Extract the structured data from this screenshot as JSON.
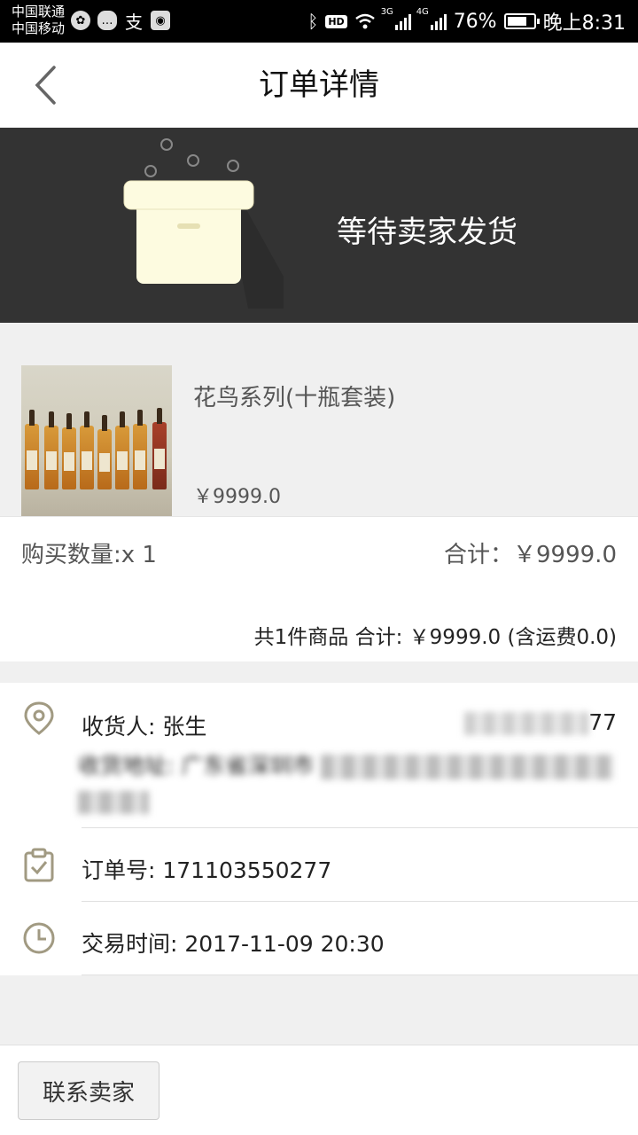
{
  "status_bar": {
    "carrier_1": "中国联通",
    "carrier_2": "中国移动",
    "hd": "HD",
    "net_1": "3G",
    "net_2": "4G",
    "battery": "76%",
    "time": "晚上8:31",
    "icons": [
      "weibo-icon",
      "chat-icon",
      "alipay-icon",
      "app-icon",
      "bluetooth-icon",
      "wifi-icon",
      "signal-icon",
      "battery-icon"
    ]
  },
  "header": {
    "title": "订单详情"
  },
  "banner": {
    "status": "等待卖家发货"
  },
  "product": {
    "name": "花鸟系列(十瓶套装)",
    "price": "￥9999.0"
  },
  "summary": {
    "quantity": "购买数量:x 1",
    "subtotal": "合计：￥9999.0",
    "grand_total": "共1件商品 合计: ￥9999.0 (含运费0.0)"
  },
  "receiver": {
    "name": "收货人: 张生",
    "phone": "77",
    "address": "收货地址: 广东省深圳市"
  },
  "order": {
    "number": "订单号: 171103550277",
    "time": "交易时间: 2017-11-09 20:30"
  },
  "actions": {
    "contact_seller": "联系卖家"
  }
}
